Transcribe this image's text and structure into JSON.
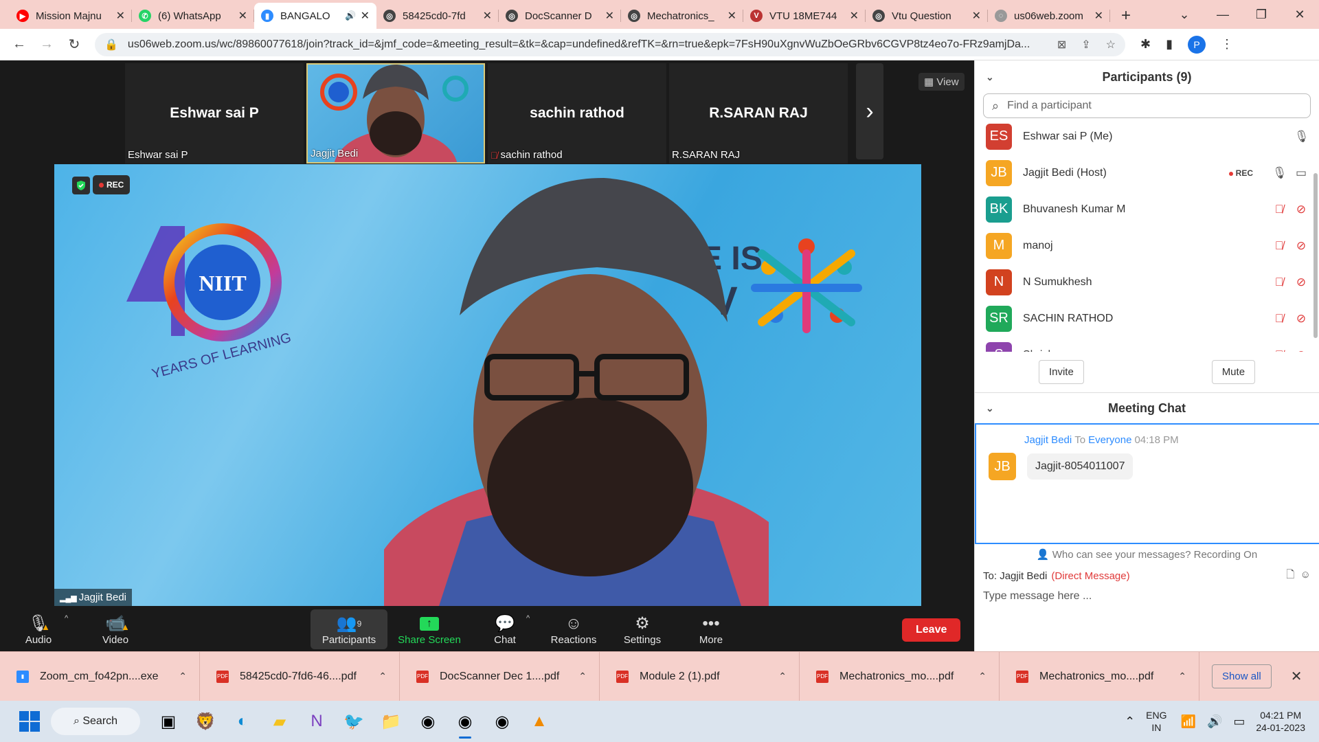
{
  "browser": {
    "tabs": [
      {
        "title": "Mission Majnu",
        "color": "#ff0000",
        "glyph": "▶"
      },
      {
        "title": "(6) WhatsApp",
        "color": "#25d366",
        "glyph": "✆"
      },
      {
        "title": "BANGALO",
        "color": "#2d8cff",
        "glyph": "▮",
        "active": true,
        "audio": "🔊"
      },
      {
        "title": "58425cd0-7fd",
        "color": "#444",
        "glyph": "◎"
      },
      {
        "title": "DocScanner D",
        "color": "#444",
        "glyph": "◎"
      },
      {
        "title": "Mechatronics_",
        "color": "#444",
        "glyph": "◎"
      },
      {
        "title": "VTU 18ME744",
        "color": "#b33",
        "glyph": "V"
      },
      {
        "title": "Vtu Question",
        "color": "#444",
        "glyph": "◎"
      },
      {
        "title": "us06web.zoom",
        "color": "#999",
        "glyph": "◌"
      }
    ],
    "url": "us06web.zoom.us/wc/89860077618/join?track_id=&jmf_code=&meeting_result=&tk=&cap=undefined&refTK=&rn=true&epk=7FsH90uXgnvWuZbOeGRbv6CGVP8tz4eo7o-FRz9amjDa...",
    "profile_initial": "P"
  },
  "gallery": {
    "thumbs": [
      {
        "name": "Eshwar sai P",
        "label": "Eshwar sai P",
        "video": false,
        "muted": false
      },
      {
        "name": "",
        "label": "Jagjit Bedi",
        "video": true,
        "muted": false
      },
      {
        "name": "sachin rathod",
        "label": "sachin rathod",
        "video": false,
        "muted": true
      },
      {
        "name": "R.SARAN RAJ",
        "label": "R.SARAN RAJ",
        "video": false,
        "muted": false
      }
    ],
    "view_label": "View"
  },
  "speaker": {
    "name": "Jagjit Bedi",
    "rec_label": "REC",
    "niit_text": "NIIT",
    "years_text": "YEARS OF LEARNING",
    "vibe_text": "E IS",
    "vibe_text2": "V"
  },
  "toolbar": {
    "audio": "Audio",
    "video": "Video",
    "participants": "Participants",
    "participants_count": "9",
    "share": "Share Screen",
    "chat": "Chat",
    "reactions": "Reactions",
    "settings": "Settings",
    "more": "More",
    "leave": "Leave"
  },
  "participants_panel": {
    "title": "Participants (9)",
    "search_placeholder": "Find a participant",
    "list": [
      {
        "initials": "ES",
        "name": "Eshwar sai P (Me)",
        "color": "#d23f31",
        "rec": false,
        "mic": "on",
        "cam": "none"
      },
      {
        "initials": "JB",
        "name": "Jagjit Bedi (Host)",
        "color": "#f5a623",
        "rec": true,
        "rec_label": "REC",
        "mic": "on",
        "cam": "on"
      },
      {
        "initials": "BK",
        "name": "Bhuvanesh Kumar M",
        "color": "#1a9e8f",
        "rec": false,
        "mic": "off",
        "cam": "off"
      },
      {
        "initials": "M",
        "name": "manoj",
        "color": "#f5a623",
        "rec": false,
        "mic": "off",
        "cam": "off"
      },
      {
        "initials": "N",
        "name": "N Sumukhesh",
        "color": "#d2421f",
        "rec": false,
        "mic": "off",
        "cam": "off"
      },
      {
        "initials": "SR",
        "name": "SACHIN RATHOD",
        "color": "#20a95a",
        "rec": false,
        "mic": "off",
        "cam": "off"
      },
      {
        "initials": "S",
        "name": "Shrishu",
        "color": "#8e44ad",
        "rec": false,
        "mic": "off",
        "cam": "off"
      }
    ],
    "invite": "Invite",
    "mute": "Mute"
  },
  "chat": {
    "title": "Meeting Chat",
    "messages": [
      {
        "from": "Jagjit Bedi",
        "to_word": "To",
        "to": "Everyone",
        "time": "04:18 PM",
        "initials": "JB",
        "color": "#f5a623",
        "text": "Jagjit-8054011007"
      }
    ],
    "visibility_note": "Who can see your messages? Recording On",
    "to_label": "To:",
    "to_name": "Jagjit Bedi",
    "direct": "(Direct Message)",
    "placeholder": "Type message here ..."
  },
  "downloads": [
    {
      "name": "Zoom_cm_fo42pn....exe",
      "type": "exe"
    },
    {
      "name": "58425cd0-7fd6-46....pdf",
      "type": "pdf"
    },
    {
      "name": "DocScanner Dec 1....pdf",
      "type": "pdf"
    },
    {
      "name": "Module 2 (1).pdf",
      "type": "pdf"
    },
    {
      "name": "Mechatronics_mo....pdf",
      "type": "pdf"
    },
    {
      "name": "Mechatronics_mo....pdf",
      "type": "pdf"
    }
  ],
  "downloads_show_all": "Show all",
  "taskbar": {
    "search": "Search",
    "lang1": "ENG",
    "lang2": "IN",
    "time": "04:21 PM",
    "date": "24-01-2023"
  }
}
